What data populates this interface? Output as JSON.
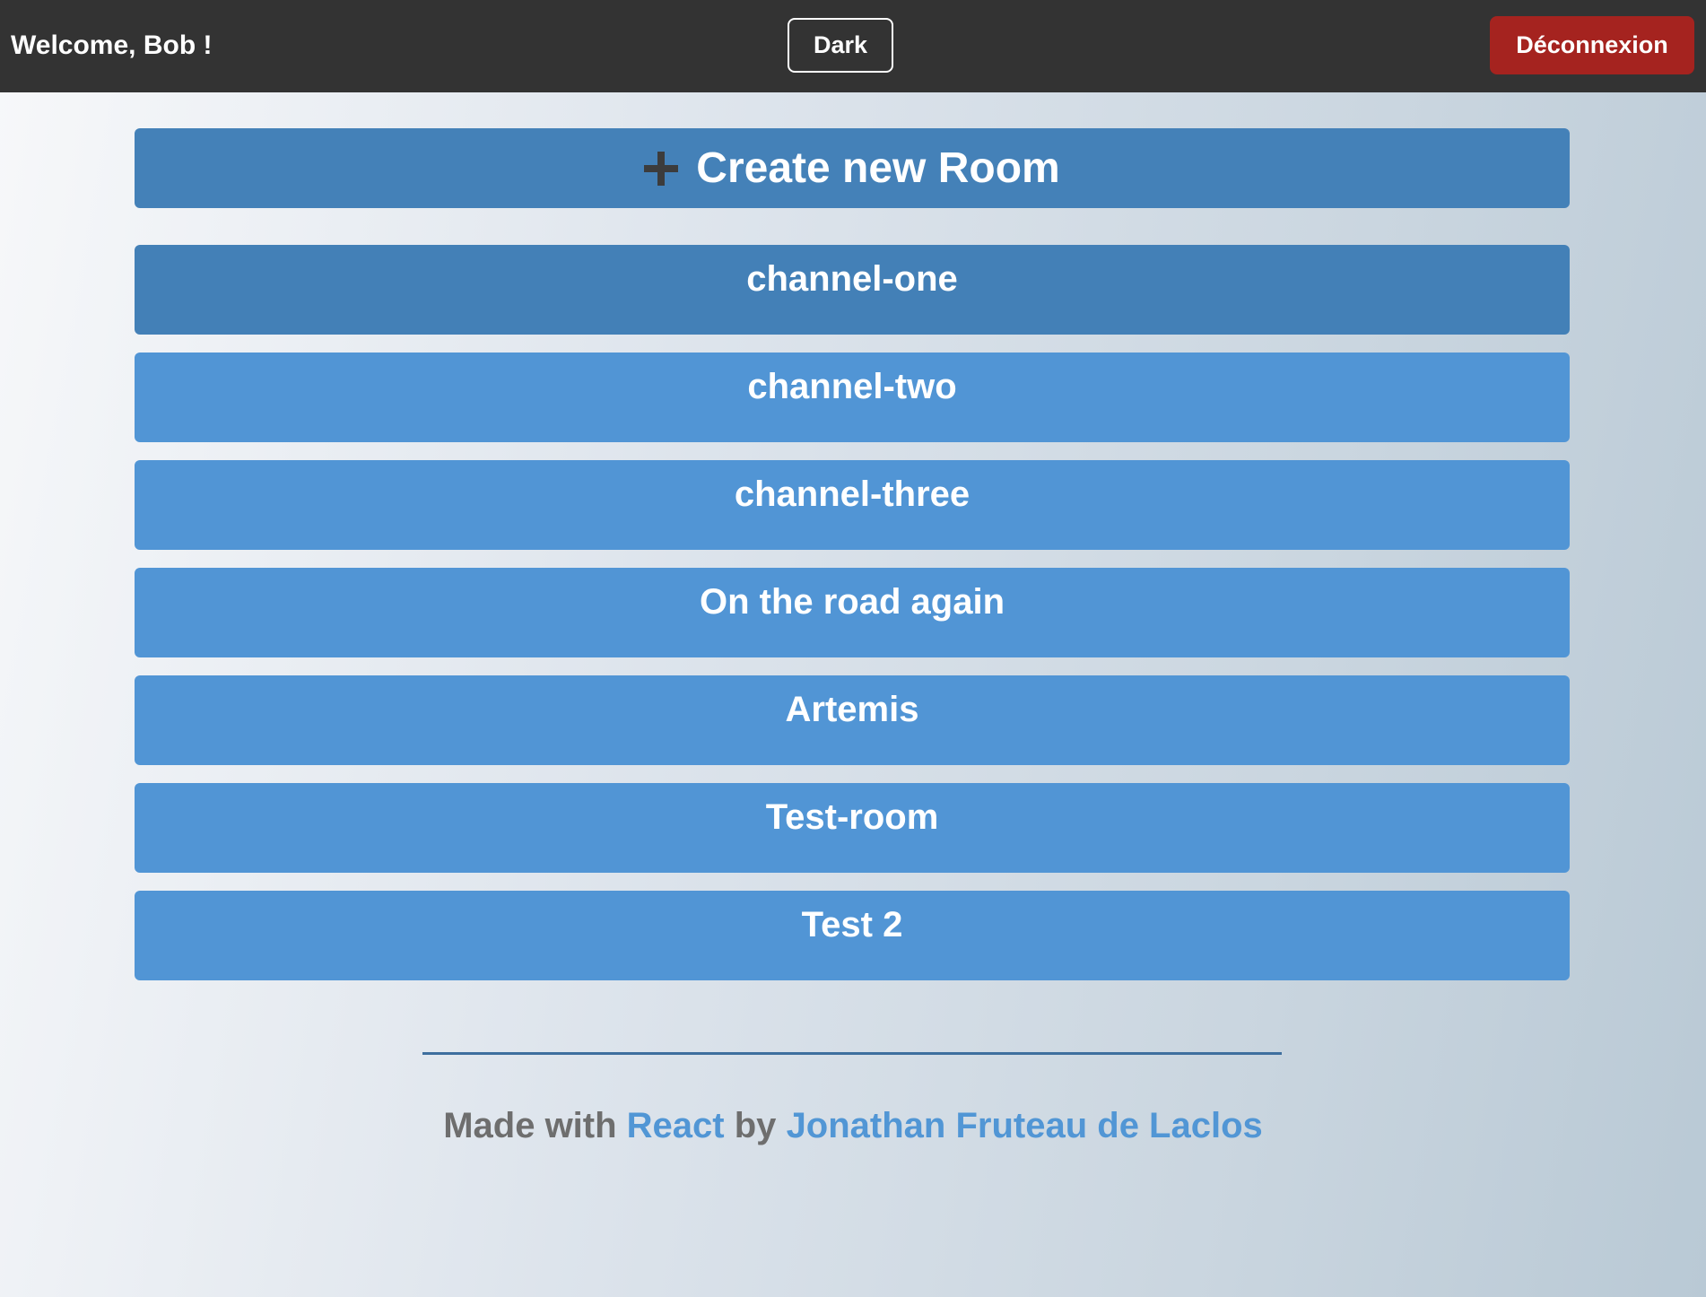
{
  "header": {
    "welcome_text": "Welcome, Bob !",
    "theme_button_label": "Dark",
    "logout_button_label": "Déconnexion"
  },
  "main": {
    "create_room_label": "Create new Room",
    "create_room_icon": "plus-icon",
    "rooms": [
      {
        "name": "channel-one",
        "active": true
      },
      {
        "name": "channel-two",
        "active": false
      },
      {
        "name": "channel-three",
        "active": false
      },
      {
        "name": "On the road again",
        "active": false
      },
      {
        "name": "Artemis",
        "active": false
      },
      {
        "name": "Test-room",
        "active": false
      },
      {
        "name": "Test 2",
        "active": false
      }
    ]
  },
  "footer": {
    "made_with": "Made with",
    "react_link": "React",
    "by": "by",
    "author_link": "Jonathan Fruteau de Laclos"
  },
  "colors": {
    "topbar": "#333333",
    "logout": "#a5231f",
    "room": "#5195d5",
    "room_active": "#4380b7",
    "link": "#5196d5"
  }
}
